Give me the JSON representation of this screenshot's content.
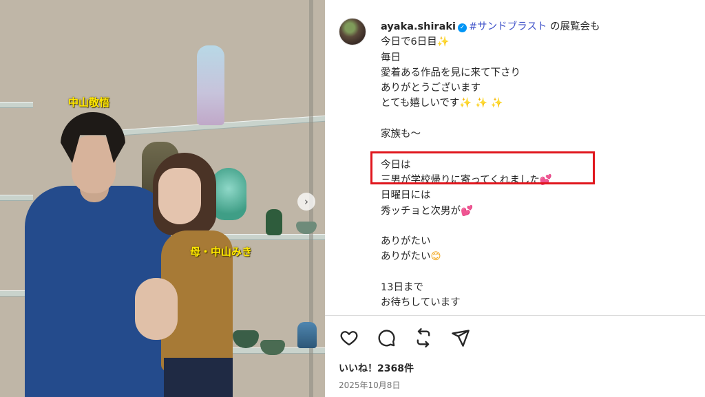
{
  "photo": {
    "label_son": "中山敬悟",
    "label_mother": "母・中山みき"
  },
  "post": {
    "username": "ayaka.shiraki",
    "hashtag": "#サンドブラスト",
    "caption_lines": [
      {
        "text": " の展覧会も"
      },
      {
        "text": "今日で6日目",
        "emoji": "✨"
      },
      {
        "text": "毎日"
      },
      {
        "text": "愛着ある作品を見に来て下さり"
      },
      {
        "text": "ありがとうございます"
      },
      {
        "text": "とても嬉しいです",
        "emoji": "✨ ✨ ✨"
      },
      {
        "text": ""
      },
      {
        "text": "家族も〜"
      },
      {
        "text": ""
      },
      {
        "text": "今日は"
      },
      {
        "text": "三男が学校帰りに寄ってくれました",
        "emoji": "💕"
      },
      {
        "text": "日曜日には"
      },
      {
        "text": "秀ッチョと次男が",
        "emoji": "💕"
      },
      {
        "text": ""
      },
      {
        "text": "ありがたい"
      },
      {
        "text": "ありがたい",
        "emoji": "😊"
      },
      {
        "text": ""
      },
      {
        "text": "13日まで"
      },
      {
        "text": "お待ちしています"
      }
    ],
    "likes": "いいね！2368件",
    "date": "2025年10月8日"
  },
  "icons": [
    "heart-icon",
    "comment-icon",
    "repost-icon",
    "share-icon",
    "verified-badge-icon",
    "chevron-right-icon"
  ],
  "colors": {
    "highlight_box": "#e0161d",
    "hashtag": "#3f52c9",
    "verified": "#0095f6",
    "photo_label": "#ffe800"
  }
}
